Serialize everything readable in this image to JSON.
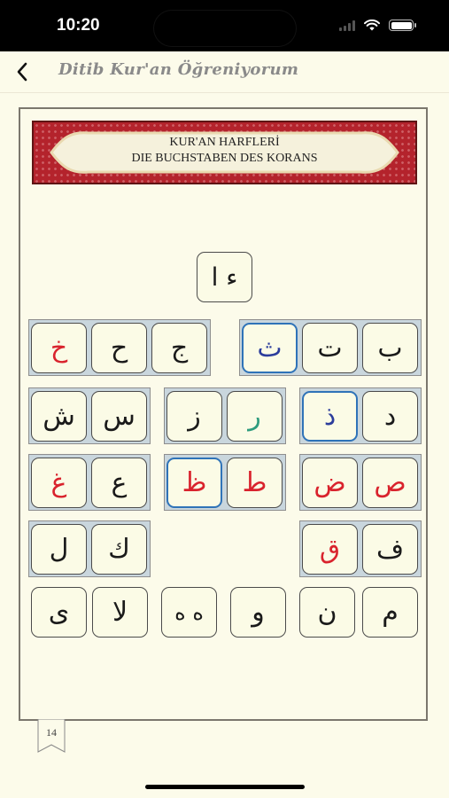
{
  "status_bar": {
    "time": "10:20"
  },
  "nav": {
    "title": "Ditib Kur'an Öğreniyorum"
  },
  "banner": {
    "line1": "KUR'AN HARFLERİ",
    "line2": "DIE BUCHSTABEN DES KORANS"
  },
  "letters": {
    "alif_hamza": "ء ا",
    "ba": "ب",
    "ta": "ت",
    "tha": "ث",
    "jim": "ج",
    "ha": "ح",
    "kha": "خ",
    "dal": "د",
    "dhal": "ذ",
    "ra": "ر",
    "zay": "ز",
    "sin": "س",
    "shin": "ش",
    "sad": "ص",
    "dad": "ض",
    "taa": "ط",
    "zaa": "ظ",
    "ayn": "ع",
    "ghayn": "غ",
    "fa": "ف",
    "qaf": "ق",
    "kaf": "ك",
    "lam": "ل",
    "mim": "م",
    "nun": "ن",
    "waw": "و",
    "haa": "ه ه",
    "lam_alif": "لا",
    "ya": "ى"
  },
  "page_number": "14",
  "colors": {
    "red": "#d9232d",
    "blue": "#2c3d9c",
    "teal": "#2f9c7e",
    "tile_highlight_border": "#2f73b8",
    "banner": "#b4232c"
  }
}
